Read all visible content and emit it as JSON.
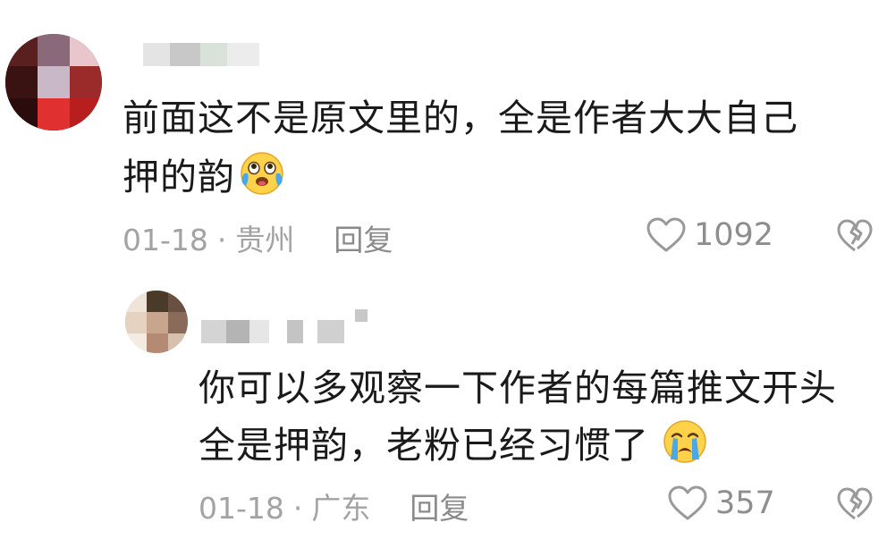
{
  "comments": [
    {
      "text_lines": [
        "前面这不是原文里的，全是作者大大自己",
        "押的韵"
      ],
      "emoji": "crying-laugh-emoji",
      "date": "01-18",
      "location": "贵州",
      "reply_label": "回复",
      "likes": "1092"
    },
    {
      "text_lines": [
        "你可以多观察一下作者的每篇推文开头",
        "全是押韵，老粉已经习惯了"
      ],
      "emoji": "crying-emoji",
      "date": "01-18",
      "location": "广东",
      "reply_label": "回复",
      "likes": "357"
    }
  ],
  "separator": "·",
  "colors": {
    "text": "#1a1a1a",
    "meta": "#a3a3a3",
    "icon": "#9a9a9a",
    "emoji_face": "#ffd24a",
    "tear": "#4aa8e8"
  }
}
